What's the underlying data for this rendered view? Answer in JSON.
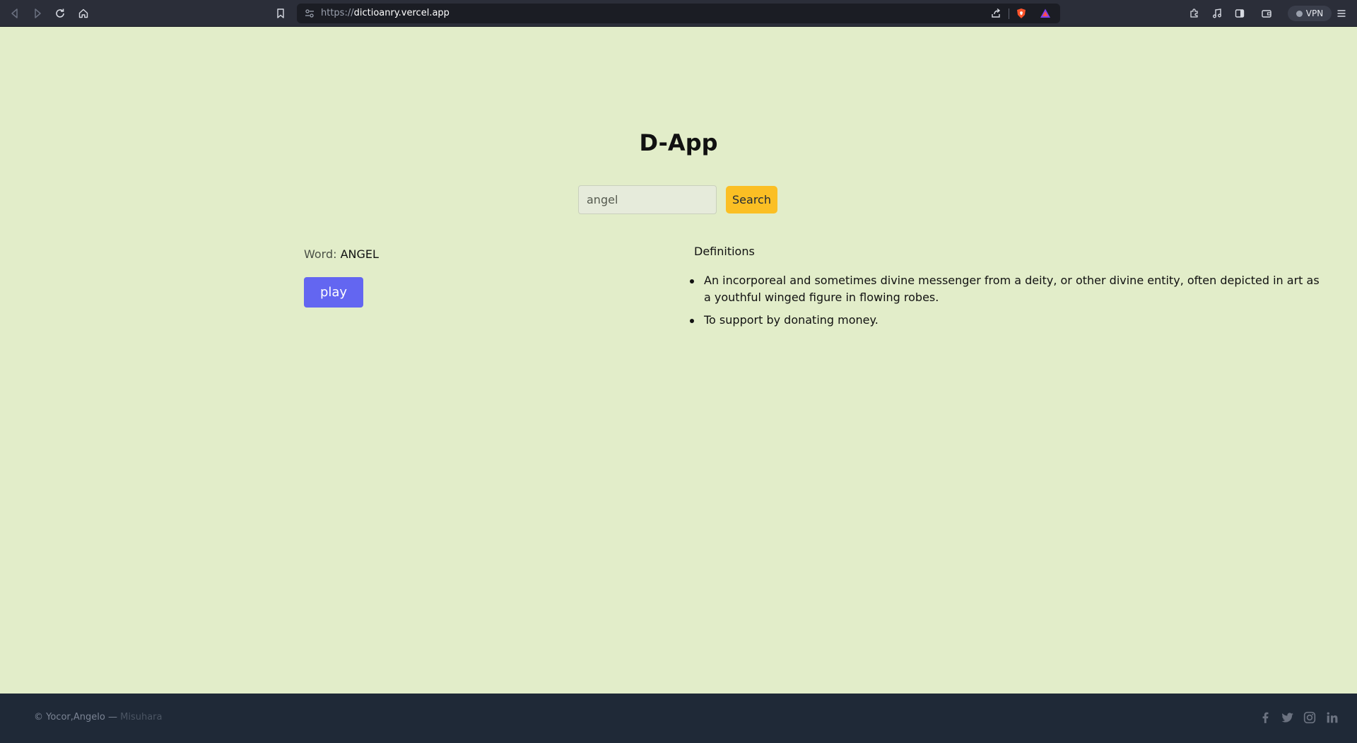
{
  "browser": {
    "url_scheme": "https://",
    "url_host": "dictioanry.vercel.app",
    "vpn_label": "VPN"
  },
  "page": {
    "title": "D-App"
  },
  "search": {
    "value": "angel",
    "button_label": "Search"
  },
  "word": {
    "label": "Word:",
    "value": "ANGEL",
    "play_label": "play"
  },
  "definitions": {
    "title": "Definitions",
    "items": [
      "An incorporeal and sometimes divine messenger from a deity, or other divine entity, often depicted in art as a youthful winged figure in flowing robes.",
      "To support by donating money."
    ]
  },
  "footer": {
    "copyright": "© Yocor,Angelo —",
    "handle": "Misuhara"
  },
  "colors": {
    "page_bg": "#e2edc9",
    "search_button": "#fbbf24",
    "play_button": "#6366f1",
    "footer_bg": "#1f2937"
  },
  "icons": {
    "browser": [
      "back-icon",
      "forward-icon",
      "reload-icon",
      "home-icon",
      "bookmark-icon",
      "site-settings-icon",
      "share-icon",
      "brave-shield-icon",
      "brave-rewards-icon",
      "extensions-icon",
      "media-icon",
      "sidebar-icon",
      "wallet-icon",
      "menu-icon"
    ],
    "footer": [
      "facebook-icon",
      "twitter-icon",
      "instagram-icon",
      "linkedin-icon"
    ]
  }
}
